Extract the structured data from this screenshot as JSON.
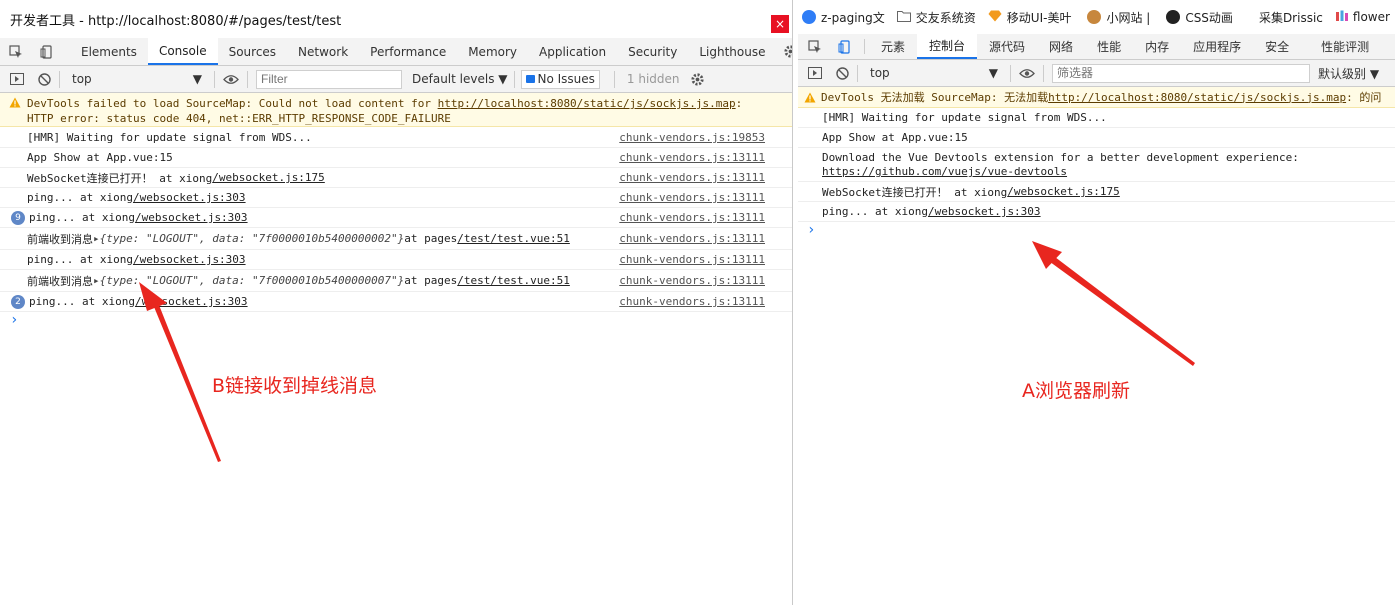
{
  "left": {
    "window_title": "开发者工具 - http://localhost:8080/#/pages/test/test",
    "close_glyph": "×",
    "tabs": [
      "Elements",
      "Console",
      "Sources",
      "Network",
      "Performance",
      "Memory",
      "Application",
      "Security",
      "Lighthouse"
    ],
    "active_tab": "Console",
    "filterbar": {
      "context": "top",
      "filter_placeholder": "Filter",
      "levels": "Default levels ▼",
      "issues": "No Issues",
      "hidden": "1 hidden"
    },
    "warning": {
      "line1_prefix": "DevTools failed to load SourceMap: Could not load content for ",
      "line1_link": "http://localhost:8080/static/js/sockjs.js.map",
      "line1_suffix": ":",
      "line2": "HTTP error: status code 404, net::ERR_HTTP_RESPONSE_CODE_FAILURE"
    },
    "messages": [
      {
        "text": "[HMR] Waiting for update signal from WDS...",
        "link": "",
        "source": "chunk-vendors.js:19853",
        "count": ""
      },
      {
        "text": "App Show  at App.vue:15",
        "link": "",
        "source": "chunk-vendors.js:13111",
        "count": ""
      },
      {
        "text": "WebSocket连接已打开！  at xiong",
        "link": "/websocket.js:175",
        "source": "chunk-vendors.js:13111",
        "count": ""
      },
      {
        "text": "ping...  at xiong",
        "link": "/websocket.js:303",
        "source": "chunk-vendors.js:13111",
        "count": ""
      },
      {
        "text": "ping...  at xiong",
        "link": "/websocket.js:303",
        "source": "chunk-vendors.js:13111",
        "count": "9"
      },
      {
        "text": "前端收到消息 ",
        "object": "▸{type: \"LOGOUT\", data: \"7f0000010b5400000002\"}",
        "after": "  at pages",
        "link": "/test/test.vue:51",
        "source": "chunk-vendors.js:13111",
        "count": ""
      },
      {
        "text": "ping...  at xiong",
        "link": "/websocket.js:303",
        "source": "chunk-vendors.js:13111",
        "count": ""
      },
      {
        "text": "前端收到消息 ",
        "object": "▸{type: \"LOGOUT\", data: \"7f0000010b5400000007\"}",
        "after": "  at pages",
        "link": "/test/test.vue:51",
        "source": "chunk-vendors.js:13111",
        "count": ""
      },
      {
        "text": "ping...  at xiong",
        "link": "/websocket.js:303",
        "source": "chunk-vendors.js:13111",
        "count": "2"
      }
    ],
    "prompt": "›"
  },
  "right": {
    "bookmarks": [
      {
        "label": "z-paging文",
        "color": "#2f7df6"
      },
      {
        "label": "交友系统资",
        "color": "#9a9a9a"
      },
      {
        "label": "移动UI-美叶",
        "color": "#f29a1e"
      },
      {
        "label": "小网站 |",
        "color": "#c7873d"
      },
      {
        "label": "CSS动画",
        "color": "#222222"
      },
      {
        "label": "采集Drissic",
        "color": "#ffffff"
      },
      {
        "label": "flower",
        "color": "#d84bb5"
      }
    ],
    "tabs": [
      "元素",
      "控制台",
      "源代码",
      "网络",
      "性能",
      "内存",
      "应用程序",
      "安全",
      "性能评测"
    ],
    "active_tab": "控制台",
    "filterbar": {
      "context": "top",
      "filter_placeholder": "筛选器",
      "levels": "默认级别 ▼"
    },
    "warning": {
      "prefix": "DevTools 无法加载 SourceMap: 无法加载 ",
      "link": "http://localhost:8080/static/js/sockjs.js.map",
      "suffix": ": 的问"
    },
    "messages": [
      {
        "text": "[HMR] Waiting for update signal from WDS...",
        "link": ""
      },
      {
        "text": "App Show  at App.vue:15",
        "link": ""
      },
      {
        "text": "Download the Vue Devtools extension for a better development experience:",
        "link2": "https://github.com/vuejs/vue-devtools",
        "link": ""
      },
      {
        "text": "WebSocket连接已打开！  at xiong",
        "link": "/websocket.js:175"
      },
      {
        "text": "ping...  at xiong",
        "link": "/websocket.js:303"
      }
    ],
    "prompt": "›"
  },
  "annotations": {
    "left_label": "B链接收到掉线消息",
    "right_label": "A浏览器刷新",
    "color": "#e8261f"
  }
}
